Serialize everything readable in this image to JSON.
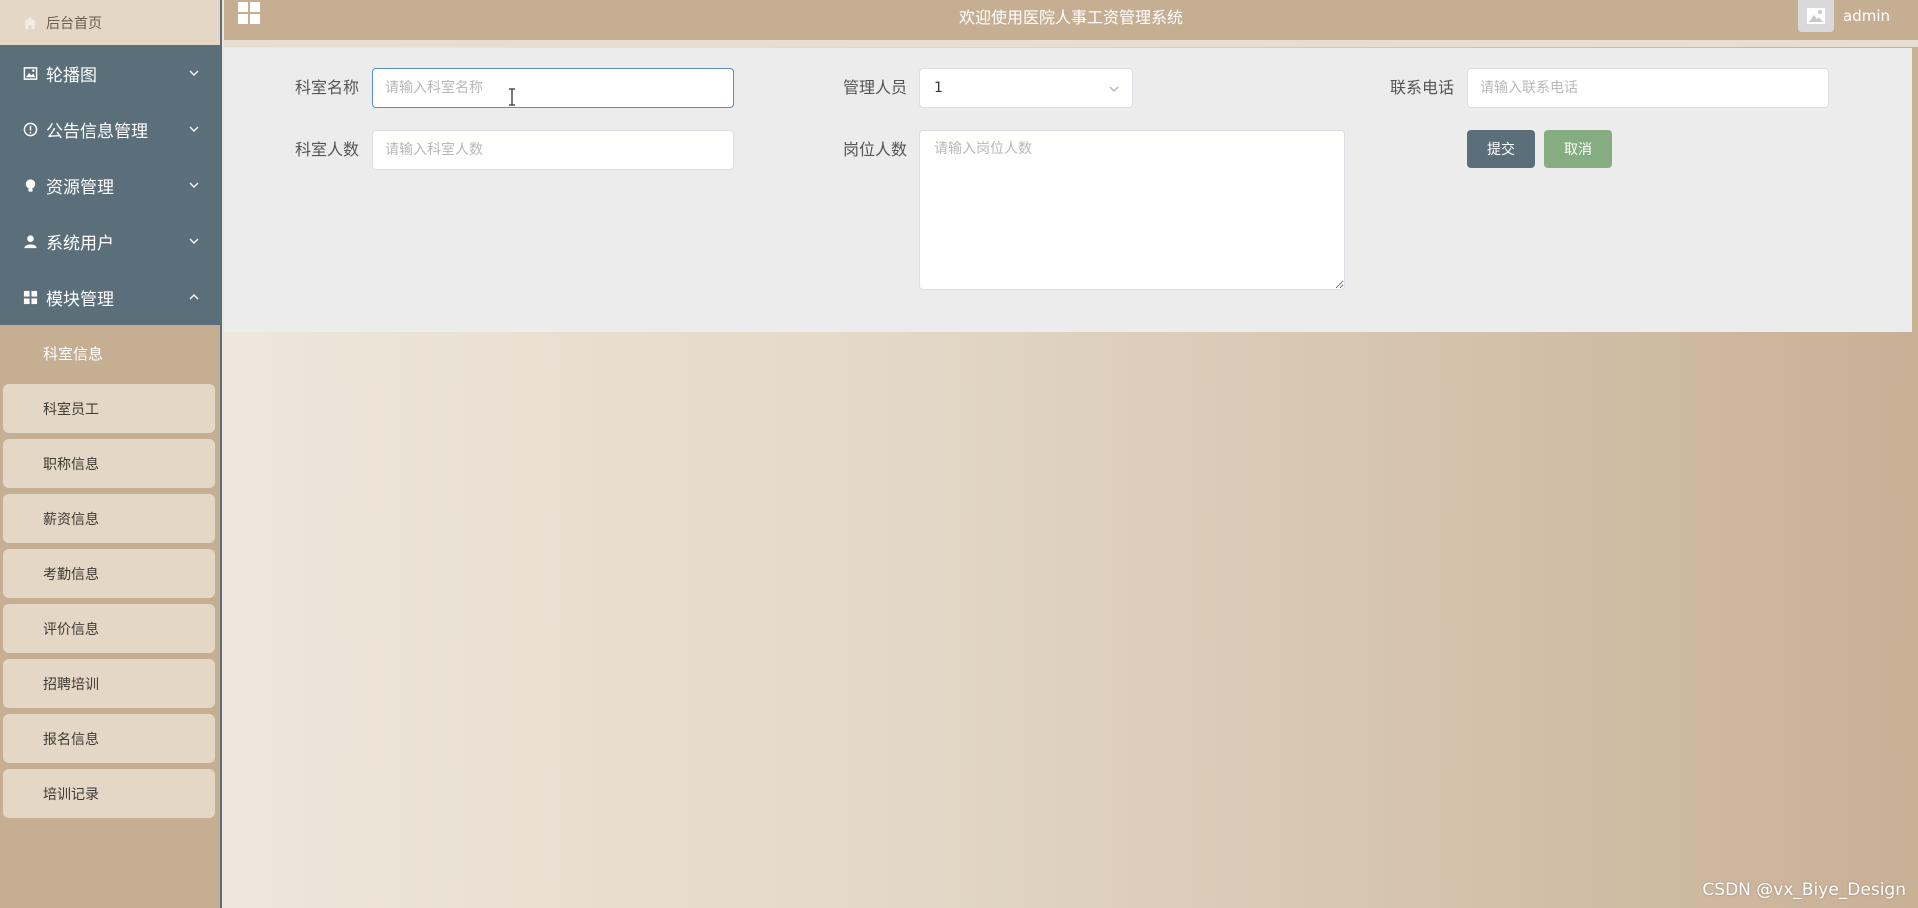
{
  "sidebar": {
    "home": {
      "label": "后台首页",
      "icon": "home-icon"
    },
    "menus": [
      {
        "label": "轮播图",
        "icon": "image-icon",
        "expanded": false
      },
      {
        "label": "公告信息管理",
        "icon": "info-circle-icon",
        "expanded": false
      },
      {
        "label": "资源管理",
        "icon": "lightbulb-icon",
        "expanded": false
      },
      {
        "label": "系统用户",
        "icon": "user-icon",
        "expanded": false
      },
      {
        "label": "模块管理",
        "icon": "grid-icon",
        "expanded": true
      }
    ],
    "submenu": [
      {
        "label": "科室信息",
        "active": true
      },
      {
        "label": "科室员工"
      },
      {
        "label": "职称信息"
      },
      {
        "label": "薪资信息"
      },
      {
        "label": "考勤信息"
      },
      {
        "label": "评价信息"
      },
      {
        "label": "招聘培训"
      },
      {
        "label": "报名信息"
      },
      {
        "label": "培训记录"
      }
    ]
  },
  "topbar": {
    "title": "欢迎使用医院人事工资管理系统",
    "username": "admin"
  },
  "form": {
    "dept_name": {
      "label": "科室名称",
      "placeholder": "请输入科室名称",
      "value": ""
    },
    "manager": {
      "label": "管理人员",
      "value": "1"
    },
    "phone": {
      "label": "联系电话",
      "placeholder": "请输入联系电话",
      "value": ""
    },
    "dept_count": {
      "label": "科室人数",
      "placeholder": "请输入科室人数",
      "value": ""
    },
    "post_count": {
      "label": "岗位人数",
      "placeholder": "请输入岗位人数",
      "value": ""
    },
    "submit_label": "提交",
    "cancel_label": "取消"
  },
  "watermark": "CSDN @vx_Biye_Design",
  "colors": {
    "sidebar_menu_bg": "#5b6f7b",
    "sidebar_sub_bg": "#e4d7c6",
    "accent_tan": "#c6ae93",
    "submit_btn": "#5b6f7b",
    "cancel_btn": "#86ad82"
  }
}
